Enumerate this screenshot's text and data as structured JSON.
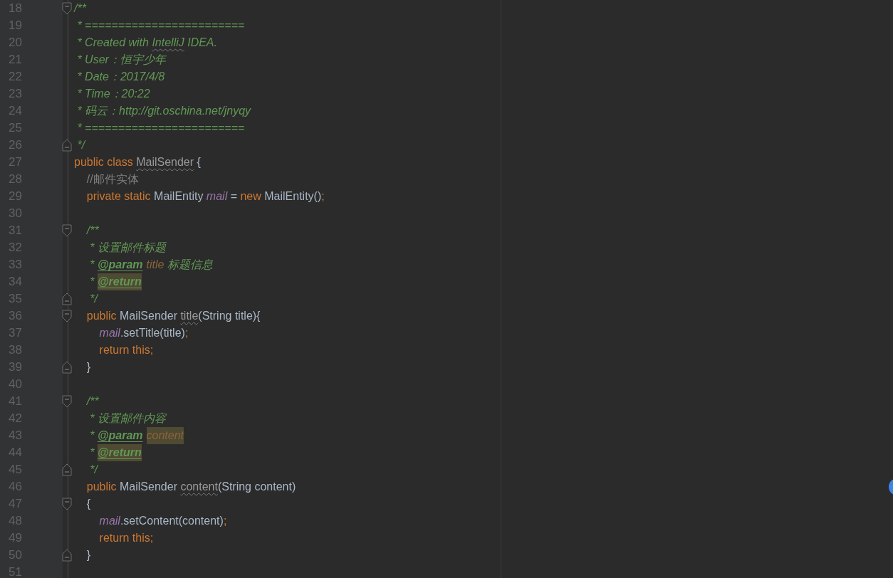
{
  "editor": {
    "lines": [
      {
        "number": "18",
        "fold_start": true,
        "tokens": [
          {
            "kind": "doc",
            "text": "/**"
          }
        ]
      },
      {
        "number": "19",
        "tokens": [
          {
            "kind": "doc",
            "text": " * ========================"
          }
        ]
      },
      {
        "number": "20",
        "tokens": [
          {
            "kind": "doc",
            "text": " * Created with "
          },
          {
            "kind": "doc",
            "text": "IntelliJ",
            "warning": true
          },
          {
            "kind": "doc",
            "text": " IDEA."
          }
        ]
      },
      {
        "number": "21",
        "tokens": [
          {
            "kind": "doc",
            "text": " * User：恒宇少年"
          }
        ]
      },
      {
        "number": "22",
        "tokens": [
          {
            "kind": "doc",
            "text": " * Date：2017/4/8"
          }
        ]
      },
      {
        "number": "23",
        "tokens": [
          {
            "kind": "doc",
            "text": " * Time：20:22"
          }
        ]
      },
      {
        "number": "24",
        "tokens": [
          {
            "kind": "doc",
            "text": " * 码云：http://git.oschina.net/jnyqy"
          }
        ]
      },
      {
        "number": "25",
        "tokens": [
          {
            "kind": "doc",
            "text": " * ========================"
          }
        ]
      },
      {
        "number": "26",
        "fold_end": true,
        "tokens": [
          {
            "kind": "doc",
            "text": " */"
          }
        ]
      },
      {
        "number": "27",
        "tokens": [
          {
            "kind": "keyword",
            "text": "public class "
          },
          {
            "kind": "unused",
            "text": "MailSender",
            "warning": true
          },
          {
            "kind": "plain",
            "text": " {"
          }
        ]
      },
      {
        "number": "28",
        "tokens": [
          {
            "kind": "comment",
            "text": "    //邮件实体"
          }
        ]
      },
      {
        "number": "29",
        "tokens": [
          {
            "kind": "keyword",
            "text": "    private static "
          },
          {
            "kind": "plain",
            "text": "MailEntity "
          },
          {
            "kind": "field",
            "text": "mail"
          },
          {
            "kind": "plain",
            "text": " = "
          },
          {
            "kind": "keyword",
            "text": "new "
          },
          {
            "kind": "plain",
            "text": "MailEntity()"
          },
          {
            "kind": "keyword",
            "text": ";"
          }
        ]
      },
      {
        "number": "30"
      },
      {
        "number": "31",
        "fold_start": true,
        "tokens": [
          {
            "kind": "doc",
            "text": "    /**"
          }
        ]
      },
      {
        "number": "32",
        "tokens": [
          {
            "kind": "doc",
            "text": "     * 设置邮件标题"
          }
        ]
      },
      {
        "number": "33",
        "tokens": [
          {
            "kind": "doc",
            "text": "     * "
          },
          {
            "kind": "tag",
            "text": "@param"
          },
          {
            "kind": "param",
            "text": "title"
          },
          {
            "kind": "doc",
            "text": " 标题信息"
          }
        ]
      },
      {
        "number": "34",
        "tokens": [
          {
            "kind": "doc",
            "text": "     * "
          },
          {
            "kind": "tag",
            "text": "@return",
            "highlighted": true
          }
        ]
      },
      {
        "number": "35",
        "fold_end": true,
        "tokens": [
          {
            "kind": "doc",
            "text": "     */"
          }
        ]
      },
      {
        "number": "36",
        "fold_start": true,
        "tokens": [
          {
            "kind": "keyword",
            "text": "    public "
          },
          {
            "kind": "plain",
            "text": "MailSender "
          },
          {
            "kind": "unused",
            "text": "title",
            "warning": true
          },
          {
            "kind": "plain",
            "text": "(String title){"
          }
        ]
      },
      {
        "number": "37",
        "tokens": [
          {
            "kind": "field",
            "text": "        mail"
          },
          {
            "kind": "plain",
            "text": ".setTitle(title)"
          },
          {
            "kind": "keyword",
            "text": ";"
          }
        ]
      },
      {
        "number": "38",
        "tokens": [
          {
            "kind": "keyword",
            "text": "        return this;"
          }
        ]
      },
      {
        "number": "39",
        "fold_end": true,
        "tokens": [
          {
            "kind": "plain",
            "text": "    }"
          }
        ]
      },
      {
        "number": "40"
      },
      {
        "number": "41",
        "fold_start": true,
        "tokens": [
          {
            "kind": "doc",
            "text": "    /**"
          }
        ]
      },
      {
        "number": "42",
        "tokens": [
          {
            "kind": "doc",
            "text": "     * 设置邮件内容"
          }
        ]
      },
      {
        "number": "43",
        "tokens": [
          {
            "kind": "doc",
            "text": "     * "
          },
          {
            "kind": "tag",
            "text": "@param"
          },
          {
            "kind": "param",
            "text": "content",
            "highlighted": true
          }
        ]
      },
      {
        "number": "44",
        "tokens": [
          {
            "kind": "doc",
            "text": "     * "
          },
          {
            "kind": "tag",
            "text": "@return",
            "highlighted": true
          }
        ]
      },
      {
        "number": "45",
        "fold_end": true,
        "tokens": [
          {
            "kind": "doc",
            "text": "     */"
          }
        ]
      },
      {
        "number": "46",
        "tokens": [
          {
            "kind": "keyword",
            "text": "    public "
          },
          {
            "kind": "plain",
            "text": "MailSender "
          },
          {
            "kind": "unused",
            "text": "content",
            "warning": true
          },
          {
            "kind": "plain",
            "text": "(String content)"
          }
        ]
      },
      {
        "number": "47",
        "fold_start": true,
        "tokens": [
          {
            "kind": "plain",
            "text": "    {"
          }
        ]
      },
      {
        "number": "48",
        "tokens": [
          {
            "kind": "field",
            "text": "        mail"
          },
          {
            "kind": "plain",
            "text": ".setContent(content)"
          },
          {
            "kind": "keyword",
            "text": ";"
          }
        ]
      },
      {
        "number": "49",
        "tokens": [
          {
            "kind": "keyword",
            "text": "        return this;"
          }
        ]
      },
      {
        "number": "50",
        "fold_end": true,
        "tokens": [
          {
            "kind": "plain",
            "text": "    }"
          }
        ]
      },
      {
        "number": "51"
      }
    ]
  }
}
